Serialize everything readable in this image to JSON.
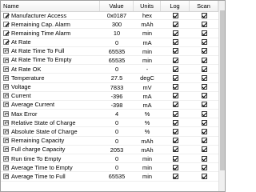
{
  "columns": {
    "name": "Name",
    "value": "Value",
    "units": "Units",
    "log": "Log",
    "scan": "Scan"
  },
  "rows": [
    {
      "icon": "pencil",
      "name": "Manufacturer Access",
      "value": "0x0187",
      "units": "hex"
    },
    {
      "icon": "pencil",
      "name": "Remaining Cap. Alarm",
      "value": "300",
      "units": "mAh"
    },
    {
      "icon": "pencil",
      "name": "Remaining Time Alarm",
      "value": "10",
      "units": "min"
    },
    {
      "icon": "pencil",
      "name": "At Rate",
      "value": "0",
      "units": "mA"
    },
    {
      "icon": "lock",
      "name": "At Rate Time To Full",
      "value": "65535",
      "units": "min"
    },
    {
      "icon": "lock",
      "name": "At Rate Time To Empty",
      "value": "65535",
      "units": "min"
    },
    {
      "icon": "lock",
      "name": "At Rate OK",
      "value": "0",
      "units": "-"
    },
    {
      "icon": "lock",
      "name": "Temperature",
      "value": "27.5",
      "units": "degC"
    },
    {
      "icon": "lock",
      "name": "Voltage",
      "value": "7833",
      "units": "mV"
    },
    {
      "icon": "lock",
      "name": "Current",
      "value": "-396",
      "units": "mA"
    },
    {
      "icon": "lock",
      "name": "Average Current",
      "value": "-398",
      "units": "mA"
    },
    {
      "icon": "lock",
      "name": "Max Error",
      "value": "4",
      "units": "%"
    },
    {
      "icon": "lock",
      "name": "Relative State of Charge",
      "value": "0",
      "units": "%"
    },
    {
      "icon": "lock",
      "name": "Absolute State of Charge",
      "value": "0",
      "units": "%"
    },
    {
      "icon": "lock",
      "name": "Remaining Capacity",
      "value": "0",
      "units": "mAh"
    },
    {
      "icon": "lock",
      "name": "Full charge Capacity",
      "value": "2053",
      "units": "mAh"
    },
    {
      "icon": "lock",
      "name": "Run time To Empty",
      "value": "0",
      "units": "min"
    },
    {
      "icon": "lock",
      "name": "Average Time to Empty",
      "value": "0",
      "units": "min"
    },
    {
      "icon": "lock",
      "name": "Average Time to Full",
      "value": "65535",
      "units": "min"
    }
  ]
}
